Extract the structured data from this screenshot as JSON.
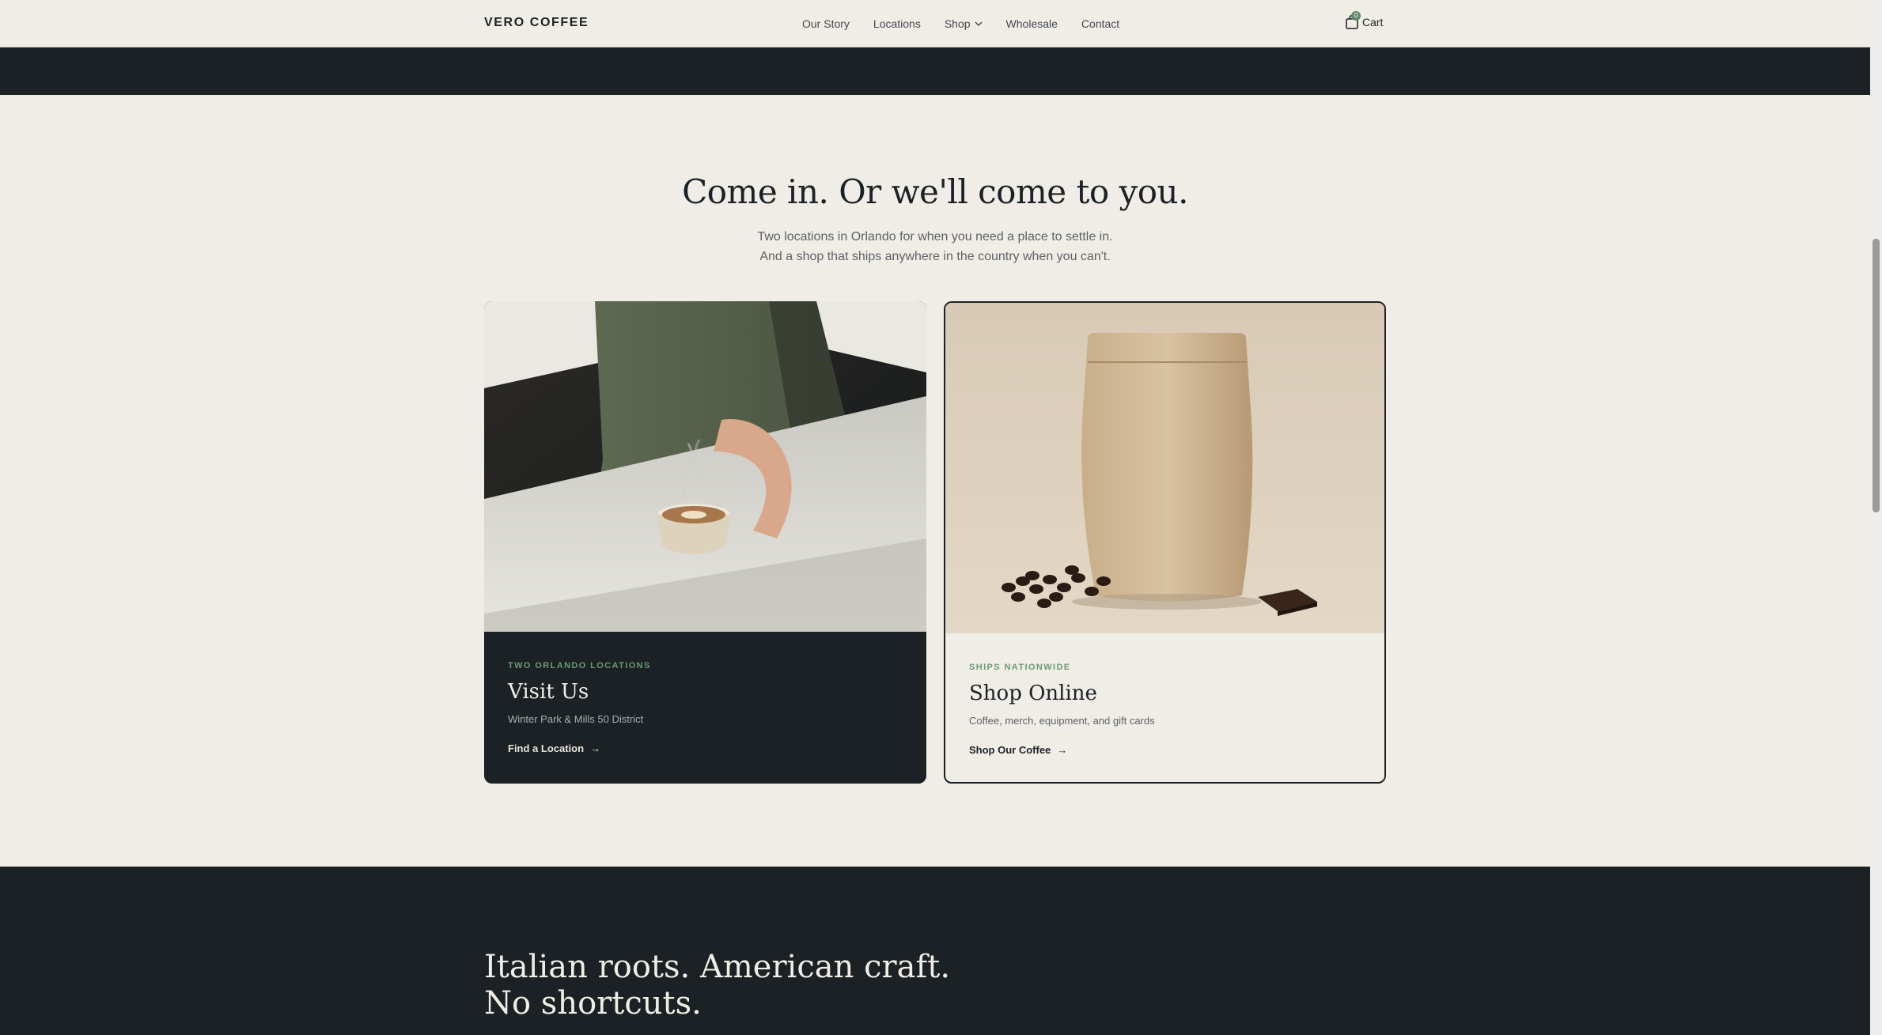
{
  "header": {
    "brand": "VERO COFFEE",
    "nav": [
      {
        "label": "Our Story"
      },
      {
        "label": "Locations"
      },
      {
        "label": "Shop"
      },
      {
        "label": "Wholesale"
      },
      {
        "label": "Contact"
      }
    ],
    "cart_label": "Cart",
    "cart_count": "0",
    "cart_icon": "shopping-bag-icon"
  },
  "section": {
    "title": "Come in. Or we'll come to you.",
    "sub_line1": "Two locations in Orlando for when you need a place to settle in.",
    "sub_line2": "And a shop that ships anywhere in the country when you can't."
  },
  "cards": [
    {
      "eyebrow": "TWO ORLANDO LOCATIONS",
      "title": "Visit Us",
      "desc": "Winter Park & Mills 50 District",
      "link": "Find a Location",
      "arrow": "→"
    },
    {
      "eyebrow": "SHIPS NATIONWIDE",
      "title": "Shop Online",
      "desc": "Coffee, merch, equipment, and gift cards",
      "link": "Shop Our Coffee",
      "arrow": "→"
    }
  ],
  "bottom": {
    "heading": "Italian roots. American craft. No shortcuts."
  },
  "colors": {
    "background": "#f0ede7",
    "dark": "#1b2124",
    "accent_green": "#6a9a78"
  }
}
